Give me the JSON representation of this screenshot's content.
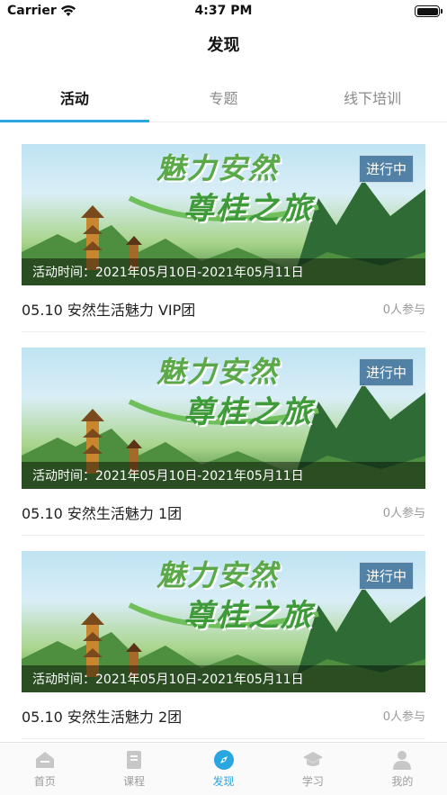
{
  "status_bar": {
    "carrier": "Carrier",
    "time": "4:37 PM",
    "battery_level": 1.0
  },
  "nav": {
    "title": "发现"
  },
  "tabs": [
    {
      "label": "活动",
      "active": true
    },
    {
      "label": "专题",
      "active": false
    },
    {
      "label": "线下培训",
      "active": false
    }
  ],
  "activities": [
    {
      "title": "05.10 安然生活魅力 VIP团",
      "participants": "0人参与",
      "status": "进行中",
      "time": "活动时间：2021年05月10日-2021年05月11日",
      "banner_text_1": "魅力安然",
      "banner_text_2": "尊桂之旅"
    },
    {
      "title": "05.10 安然生活魅力 1团",
      "participants": "0人参与",
      "status": "进行中",
      "time": "活动时间：2021年05月10日-2021年05月11日",
      "banner_text_1": "魅力安然",
      "banner_text_2": "尊桂之旅"
    },
    {
      "title": "05.10 安然生活魅力 2团",
      "participants": "0人参与",
      "status": "进行中",
      "time": "活动时间：2021年05月10日-2021年05月11日",
      "banner_text_1": "魅力安然",
      "banner_text_2": "尊桂之旅"
    }
  ],
  "tabbar": [
    {
      "label": "首页",
      "icon": "home-icon",
      "active": false
    },
    {
      "label": "课程",
      "icon": "course-icon",
      "active": false
    },
    {
      "label": "发现",
      "icon": "compass-icon",
      "active": true
    },
    {
      "label": "学习",
      "icon": "graduation-cap-icon",
      "active": false
    },
    {
      "label": "我的",
      "icon": "person-icon",
      "active": false
    }
  ],
  "colors": {
    "accent": "#2aa6e0",
    "inactive": "#9c9c9c",
    "text": "#222222"
  }
}
